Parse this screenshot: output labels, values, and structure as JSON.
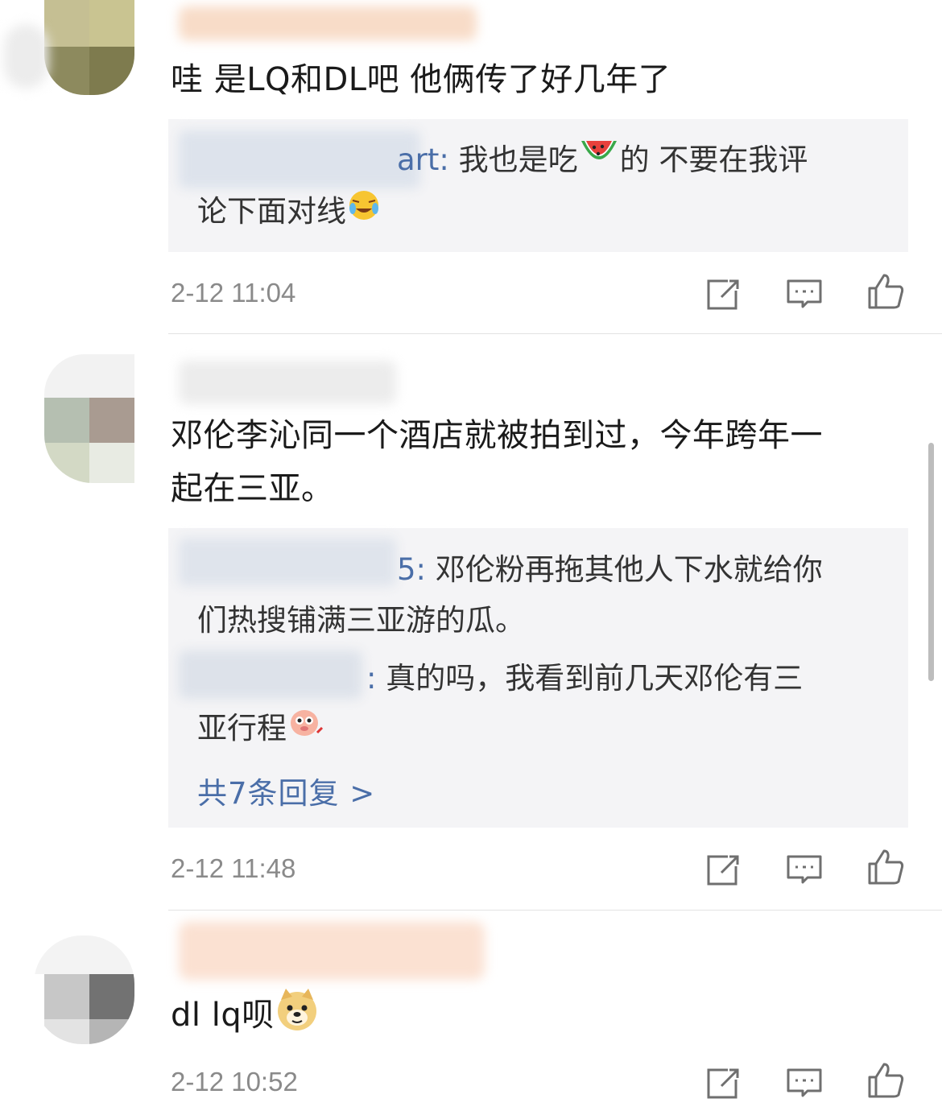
{
  "comments": [
    {
      "text": "哇 是LQ和DL吧 他俩传了好几年了",
      "replies": [
        {
          "user_suffix": "art",
          "text_a": "我也是吃",
          "emoji_a": "watermelon-emoji",
          "text_b": "的 不要在我评",
          "text_c": "论下面对线",
          "emoji_c": "laughing-crying-emoji"
        }
      ],
      "time": "2-12 11:04"
    },
    {
      "text_line1": "邓伦李沁同一个酒店就被拍到过，今年跨年一",
      "text_line2": "起在三亚。",
      "replies": [
        {
          "user_suffix": "5",
          "line1": "邓伦粉再拖其他人下水就给你",
          "line2": "们热搜铺满三亚游的瓜。"
        },
        {
          "user_suffix": "",
          "line1": "真的吗，我看到前几天邓伦有三",
          "line2": "亚行程",
          "emoji": "cute-pig-emoji"
        }
      ],
      "more_replies": "共7条回复 >",
      "time": "2-12 11:48"
    },
    {
      "text": "dl lq呗",
      "emoji": "doge-emoji",
      "time": "2-12 10:52"
    }
  ],
  "colors": {
    "link": "#4a6ea8",
    "reply_bg": "#f4f4f6",
    "time": "#8a8a8a"
  }
}
